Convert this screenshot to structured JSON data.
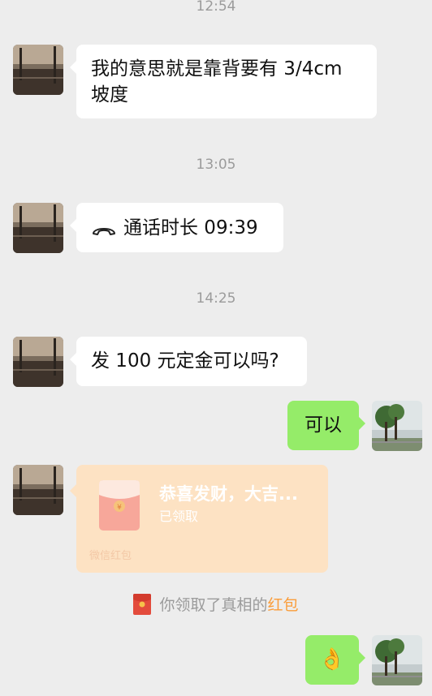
{
  "timestamps": [
    "12:54",
    "13:05",
    "14:25"
  ],
  "messages": {
    "m1": "我的意思就是靠背要有 3/4cm",
    "m1b": "坡度",
    "call": "通话时长 09:39",
    "m3": "发 100 元定金可以吗?",
    "m4": "可以",
    "emoji": "👌"
  },
  "red_packet": {
    "title": "恭喜发财，大吉...",
    "status": "已领取",
    "footer": "微信红包"
  },
  "system": {
    "prefix": "你领取了真相的",
    "highlight": "红包"
  },
  "icons": {
    "call": "phone-icon",
    "red_packet": "red-envelope-icon"
  },
  "colors": {
    "background": "#ededed",
    "bubble_incoming": "#ffffff",
    "bubble_outgoing": "#95ec69",
    "red_packet_bg": "#fde2c3",
    "highlight": "#fa9d3b"
  }
}
